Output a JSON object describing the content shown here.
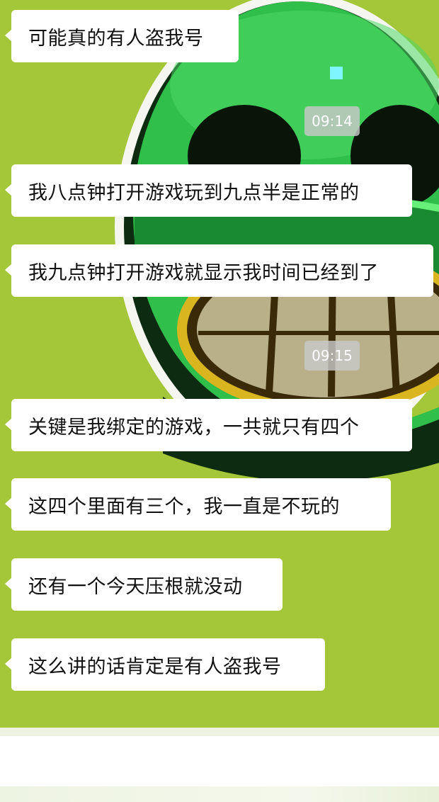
{
  "wallpaper": {
    "icon": "green-grinning-face-icon",
    "colors": {
      "background": "#a4c639",
      "face": "#2fbf4a",
      "outline": "#0a2a0a",
      "teeth": "#b9b08a",
      "gold_rim": "#d9b520"
    }
  },
  "messages": [
    {
      "text": "可能真的有人盗我号"
    },
    {
      "text": "我八点钟打开游戏玩到九点半是正常的"
    },
    {
      "text": "我九点钟打开游戏就显示我时间已经到了"
    },
    {
      "text": "关键是我绑定的游戏，一共就只有四个"
    },
    {
      "text": "这四个里面有三个，我一直是不玩的"
    },
    {
      "text": "还有一个今天压根就没动"
    },
    {
      "text": "这么讲的话肯定是有人盗我号"
    }
  ],
  "timestamps": [
    "09:14",
    "09:15"
  ]
}
